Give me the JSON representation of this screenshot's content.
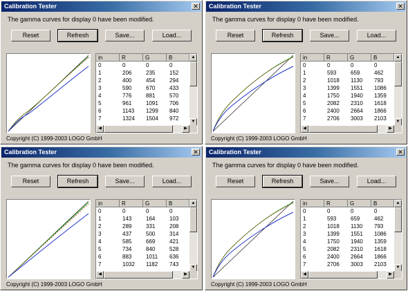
{
  "windows": [
    {
      "title": "Calibration Tester",
      "close_glyph": "✕",
      "message": "The gamma curves for display 0 have been modified.",
      "buttons": {
        "reset": "Reset",
        "refresh": "Refresh",
        "save": "Save...",
        "load": "Load..."
      },
      "table": {
        "headers": [
          "in",
          "R",
          "G",
          "B"
        ],
        "rows": [
          [
            "0",
            "0",
            "0",
            "0"
          ],
          [
            "1",
            "206",
            "235",
            "152"
          ],
          [
            "2",
            "400",
            "454",
            "294"
          ],
          [
            "3",
            "590",
            "670",
            "433"
          ],
          [
            "4",
            "776",
            "881",
            "570"
          ],
          [
            "5",
            "961",
            "1091",
            "706"
          ],
          [
            "6",
            "1143",
            "1299",
            "840"
          ],
          [
            "7",
            "1324",
            "1504",
            "972"
          ]
        ]
      },
      "copyright": "Copyright (C) 1999-2003 LOGO GmbH"
    },
    {
      "title": "Calibration Tester",
      "close_glyph": "✕",
      "message": "The gamma curves for display 0 have been modified.",
      "buttons": {
        "reset": "Reset",
        "refresh": "Refresh",
        "save": "Save...",
        "load": "Load..."
      },
      "table": {
        "headers": [
          "in",
          "R",
          "G",
          "B"
        ],
        "rows": [
          [
            "0",
            "0",
            "0",
            "0"
          ],
          [
            "1",
            "593",
            "659",
            "462"
          ],
          [
            "2",
            "1018",
            "1130",
            "793"
          ],
          [
            "3",
            "1399",
            "1551",
            "1086"
          ],
          [
            "4",
            "1750",
            "1940",
            "1359"
          ],
          [
            "5",
            "2082",
            "2310",
            "1618"
          ],
          [
            "6",
            "2400",
            "2664",
            "1866"
          ],
          [
            "7",
            "2706",
            "3003",
            "2103"
          ]
        ]
      },
      "copyright": "Copyright (C) 1999-2003 LOGO GmbH"
    },
    {
      "title": "Calibration Tester",
      "close_glyph": "✕",
      "message": "The gamma curves for display 0 have been modified.",
      "buttons": {
        "reset": "Reset",
        "refresh": "Refresh",
        "save": "Save...",
        "load": "Load..."
      },
      "table": {
        "headers": [
          "in",
          "R",
          "G",
          "B"
        ],
        "rows": [
          [
            "0",
            "0",
            "0",
            "0"
          ],
          [
            "1",
            "143",
            "164",
            "103"
          ],
          [
            "2",
            "289",
            "331",
            "208"
          ],
          [
            "3",
            "437",
            "500",
            "314"
          ],
          [
            "4",
            "585",
            "669",
            "421"
          ],
          [
            "5",
            "734",
            "840",
            "528"
          ],
          [
            "6",
            "883",
            "1011",
            "636"
          ],
          [
            "7",
            "1032",
            "1182",
            "743"
          ]
        ]
      },
      "copyright": "Copyright (C) 1999-2003 LOGO GmbH"
    },
    {
      "title": "Calibration Tester",
      "close_glyph": "✕",
      "message": "The gamma curves for display 0 have been modified.",
      "buttons": {
        "reset": "Reset",
        "refresh": "Refresh",
        "save": "Save...",
        "load": "Load..."
      },
      "table": {
        "headers": [
          "in",
          "R",
          "G",
          "B"
        ],
        "rows": [
          [
            "0",
            "0",
            "0",
            "0"
          ],
          [
            "1",
            "593",
            "659",
            "462"
          ],
          [
            "2",
            "1018",
            "1130",
            "793"
          ],
          [
            "3",
            "1399",
            "1551",
            "1086"
          ],
          [
            "4",
            "1750",
            "1940",
            "1359"
          ],
          [
            "5",
            "2082",
            "2310",
            "1618"
          ],
          [
            "6",
            "2400",
            "2664",
            "1866"
          ],
          [
            "7",
            "2706",
            "3003",
            "2103"
          ]
        ]
      },
      "copyright": "Copyright (C) 1999-2003 LOGO GmbH"
    }
  ],
  "scrollbar_glyphs": {
    "up": "▲",
    "down": "▼",
    "left": "◀",
    "right": "▶"
  },
  "curve_colors": {
    "red": "#cc2222",
    "green": "#22aa22",
    "blue": "#2233cc",
    "diagonal": "#000000"
  }
}
